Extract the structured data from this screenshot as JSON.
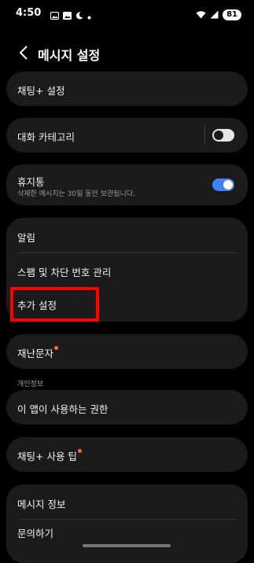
{
  "status_bar": {
    "time": "4:50",
    "battery": "81",
    "left_icons": [
      "gallery-icon",
      "image-icon",
      "moon-icon",
      "dot-icon"
    ],
    "right_icons": [
      "wifi-icon",
      "signal-icon",
      "battery-icon"
    ]
  },
  "header": {
    "title": "메시지 설정"
  },
  "cards": {
    "chat_plus_settings": "채팅+ 설정",
    "conversation_category": {
      "label": "대화 카테고리",
      "toggle_on": false
    },
    "trash": {
      "label": "휴지통",
      "subtitle": "삭제한 메시지는 30일 동안 보관됩니다.",
      "toggle_on": true
    },
    "group": {
      "notifications": "알림",
      "spam_block": "스팸 및 차단 번호 관리",
      "more_settings": "추가 설정"
    },
    "disaster_messages": "재난문자",
    "privacy_section_label": "개인정보",
    "app_permissions": "이 앱이 사용하는 권한",
    "chat_plus_tips": "채팅+ 사용 팁",
    "bottom_group": {
      "message_info": "메시지 정보",
      "contact_us": "문의하기"
    }
  },
  "colors": {
    "background": "#000000",
    "card": "#1b1b1b",
    "accent": "#3e82f7",
    "toggle_off": "#e6e6e6",
    "badge_dot": "#ff6a3d",
    "highlight": "#ff0000"
  }
}
